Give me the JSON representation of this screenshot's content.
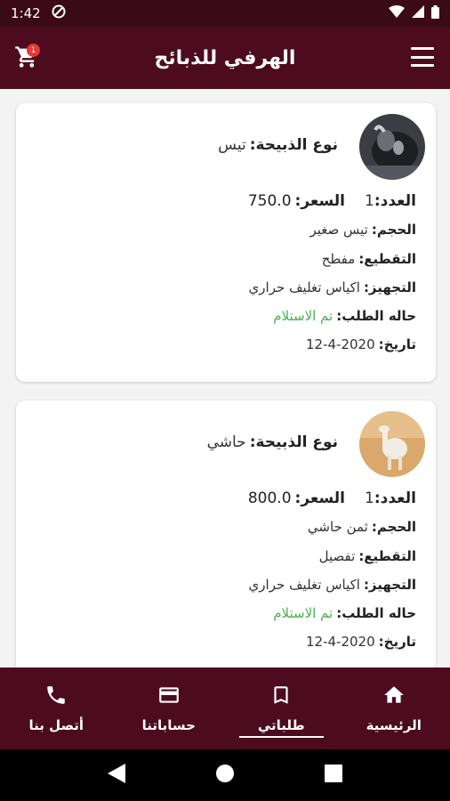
{
  "status_bar": {
    "time": "1:42"
  },
  "app_bar": {
    "title": "الهرفي للذبائح",
    "cart_badge": "1"
  },
  "orders": [
    {
      "type_label": "نوع الذبيحة:",
      "type_value": "تيس",
      "qty_label": "العدد:",
      "qty_value": "1",
      "price_label": "السعر:",
      "price_value": "750.0",
      "size_label": "الحجم:",
      "size_value": "تيس صغير",
      "cut_label": "التقطيع:",
      "cut_value": "مفطح",
      "prep_label": "التجهيز:",
      "prep_value": "اكياس تغليف حراري",
      "status_label": "حاله الطلب:",
      "status_value": "تم الاستلام",
      "date_label": "تاريخ:",
      "date_value": "12-4-2020"
    },
    {
      "type_label": "نوع الذبيحة:",
      "type_value": "حاشي",
      "qty_label": "العدد:",
      "qty_value": "1",
      "price_label": "السعر:",
      "price_value": "800.0",
      "size_label": "الحجم:",
      "size_value": "ثمن حاشي",
      "cut_label": "التقطيع:",
      "cut_value": "تفصيل",
      "prep_label": "التجهيز:",
      "prep_value": "اكياس تغليف حراري",
      "status_label": "حاله الطلب:",
      "status_value": "تم الاستلام",
      "date_label": "تاريخ:",
      "date_value": "12-4-2020"
    }
  ],
  "bottom_nav": {
    "home": "الرئيسية",
    "orders": "طلباتي",
    "accounts": "حساباتنا",
    "contact": "أتصل بنا"
  },
  "colors": {
    "primary": "#4c0b1f",
    "status_bar": "#3a0a17",
    "status_green": "#4caf50",
    "badge": "#e53935"
  },
  "icons": {
    "menu": "hamburger-icon",
    "cart": "cart-icon",
    "home": "home-icon",
    "orders": "bookmark-icon",
    "accounts": "credit-card-icon",
    "contact": "phone-icon"
  }
}
